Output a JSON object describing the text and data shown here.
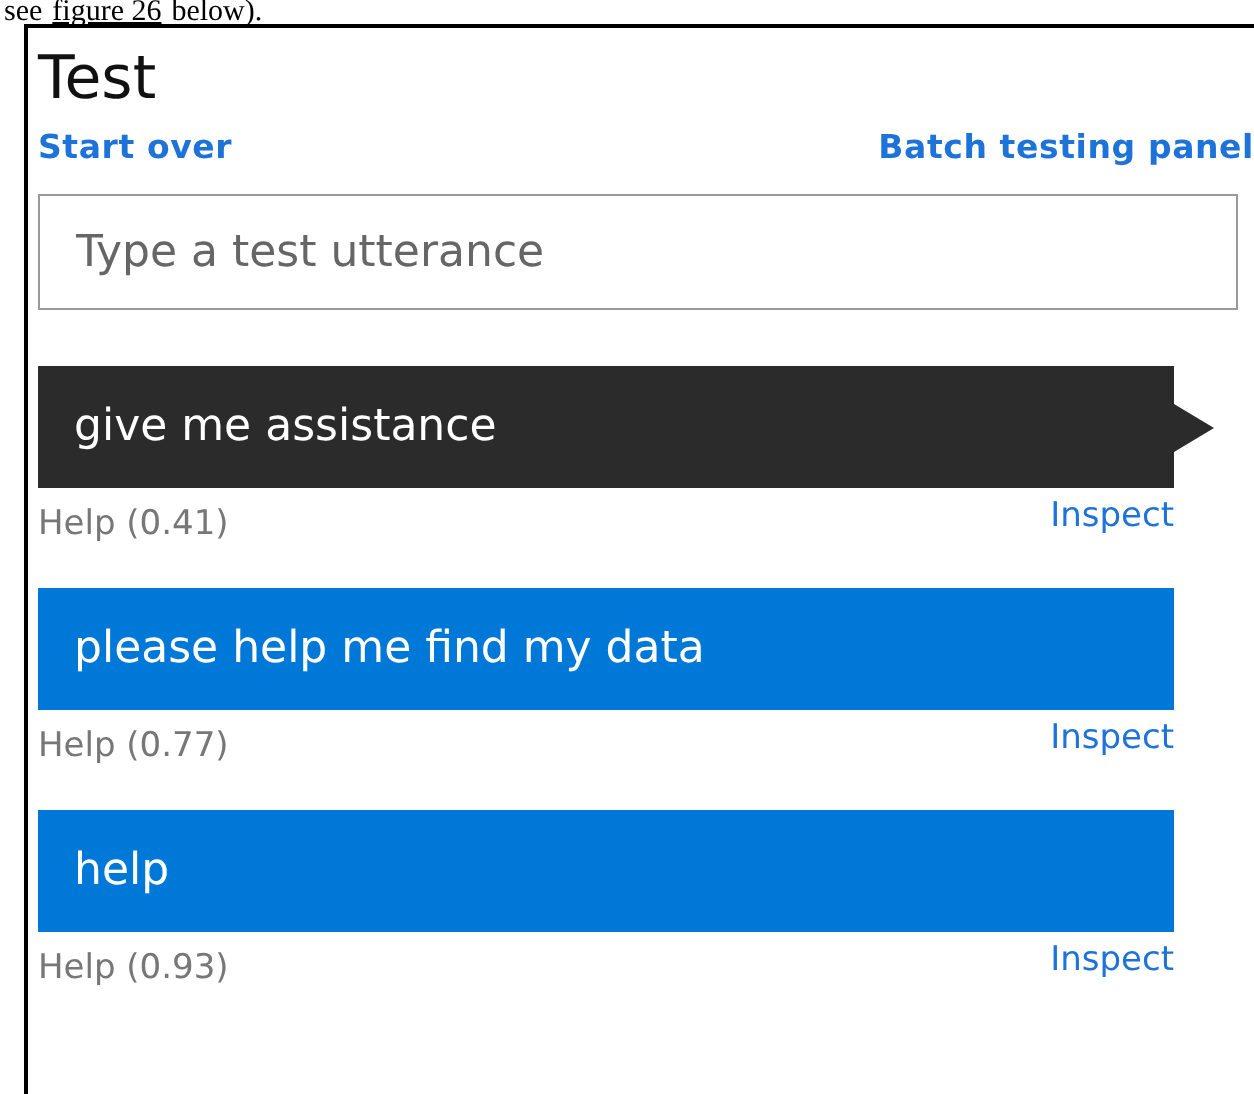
{
  "document_text": {
    "before": "see",
    "link": "figure 26",
    "after": "below)."
  },
  "panel": {
    "title": "Test",
    "start_over": "Start over",
    "batch_link": "Batch testing panel",
    "input": {
      "placeholder": "Type a test utterance"
    },
    "utterances": [
      {
        "text": "give me assistance",
        "result": "Help (0.41)",
        "action": "Inspect",
        "selected": true
      },
      {
        "text": "please help me find my data",
        "result": "Help (0.77)",
        "action": "Inspect",
        "selected": false
      },
      {
        "text": "help",
        "result": "Help (0.93)",
        "action": "Inspect",
        "selected": false
      }
    ]
  }
}
